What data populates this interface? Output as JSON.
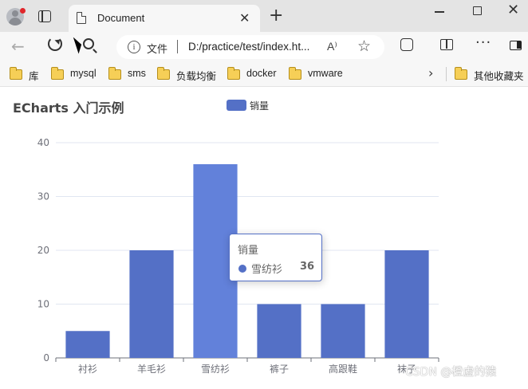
{
  "browser": {
    "tab": {
      "title": "Document",
      "close_glyph": "✕"
    },
    "new_tab_glyph": "+",
    "window": {
      "close_glyph": "✕"
    },
    "address": {
      "scheme_label": "文件",
      "url": "D:/practice/test/index.ht...",
      "read_aloud_glyph": "A⁾",
      "star_glyph": "☆",
      "more_glyph": "···"
    },
    "icons": [
      "profile-avatar-icon",
      "tab-actions-icon",
      "document-icon",
      "back-icon",
      "refresh-icon",
      "search-icon",
      "info-icon",
      "read-aloud-icon",
      "favorite-star-icon",
      "extensions-icon",
      "split-screen-icon",
      "more-icon",
      "sidebar-icon"
    ],
    "bookmarks": [
      {
        "label": "库"
      },
      {
        "label": "mysql"
      },
      {
        "label": "sms"
      },
      {
        "label": "负载均衡"
      },
      {
        "label": "docker"
      },
      {
        "label": "vmware"
      }
    ],
    "bookmarks_chevron": "›",
    "other_bookmarks": "其他收藏夹"
  },
  "page": {
    "watermark": "CSDN @橙虚的猿"
  },
  "chart_data": {
    "type": "bar",
    "title": "ECharts 入门示例",
    "legend": [
      "销量"
    ],
    "legend_position": "top-center",
    "categories": [
      "衬衫",
      "羊毛衫",
      "雪纺衫",
      "裤子",
      "高跟鞋",
      "袜子"
    ],
    "series": [
      {
        "name": "销量",
        "values": [
          5,
          20,
          36,
          10,
          10,
          20
        ]
      }
    ],
    "ylim": [
      0,
      40
    ],
    "yticks": [
      0,
      10,
      20,
      30,
      40
    ],
    "grid": true,
    "color": "#5470c6",
    "tooltip": {
      "series": "销量",
      "name": "雪纺衫",
      "value": "36"
    }
  }
}
